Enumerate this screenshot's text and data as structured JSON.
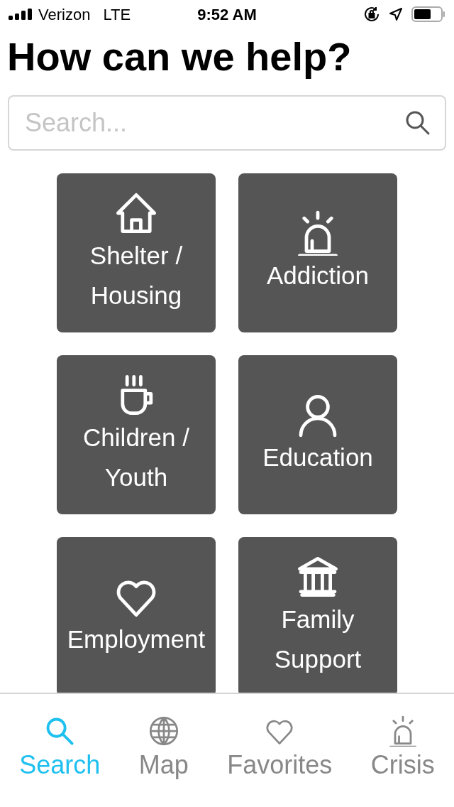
{
  "status_bar": {
    "carrier": "Verizon",
    "network": "LTE",
    "time": "9:52 AM"
  },
  "title": "How can we help?",
  "search": {
    "placeholder": "Search..."
  },
  "categories": [
    {
      "label": "Shelter / Housing"
    },
    {
      "label": "Addiction"
    },
    {
      "label": "Children / Youth"
    },
    {
      "label": "Education"
    },
    {
      "label": "Employment"
    },
    {
      "label": "Family Support"
    }
  ],
  "tabs": [
    {
      "label": "Search",
      "selected": true
    },
    {
      "label": "Map",
      "selected": false
    },
    {
      "label": "Favorites",
      "selected": false
    },
    {
      "label": "Crisis",
      "selected": false
    }
  ]
}
